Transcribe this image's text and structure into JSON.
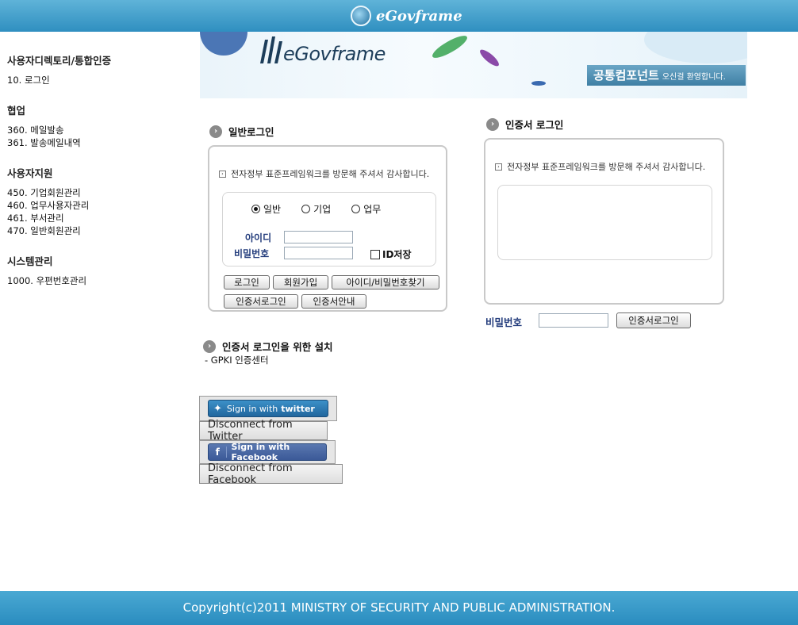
{
  "header": {
    "logo_text": "eGovframe"
  },
  "banner": {
    "brand": "eGovframe",
    "pill_bold": "공통컴포넌트",
    "pill_text": "오신걸 환영합니다."
  },
  "sidebar": {
    "sections": [
      {
        "title": "사용자디렉토리/통합인증",
        "items": [
          "10. 로그인"
        ]
      },
      {
        "title": "협업",
        "items": [
          "360. 메일발송",
          "361. 발송메일내역"
        ]
      },
      {
        "title": "사용자지원",
        "items": [
          "450. 기업회원관리",
          "460. 업무사용자관리",
          "461. 부서관리",
          "470. 일반회원관리"
        ]
      },
      {
        "title": "시스템관리",
        "items": [
          "1000. 우편번호관리"
        ]
      }
    ]
  },
  "general_login": {
    "title": "일반로그인",
    "welcome": "전자정부 표준프레임워크를 방문해 주셔서 감사합니다.",
    "radios": [
      {
        "label": "일반",
        "checked": true
      },
      {
        "label": "기업",
        "checked": false
      },
      {
        "label": "업무",
        "checked": false
      }
    ],
    "id_label": "아이디",
    "id_value": "",
    "password_label": "비밀번호",
    "password_value": "",
    "save_id_label": "ID저장",
    "buttons": {
      "login": "로그인",
      "join": "회원가입",
      "find": "아이디/비밀번호찾기",
      "cert_login": "인증서로그인",
      "cert_guide": "인증서안내"
    }
  },
  "cert_login": {
    "title": "인증서 로그인",
    "welcome": "전자정부 표준프레임워크를 방문해 주셔서 감사합니다.",
    "password_label": "비밀번호",
    "password_value": "",
    "button": "인증서로그인"
  },
  "install": {
    "title": "인증서 로그인을 위한 설치",
    "item": "- GPKI 인증센터"
  },
  "social": {
    "twitter_sign_in": "Sign in with",
    "twitter_brand": "twitter",
    "twitter_disconnect": "Disconnect from Twitter",
    "facebook_sign_in": "Sign in with Facebook",
    "facebook_disconnect": "Disconnect from Facebook"
  },
  "footer": {
    "copyright": "Copyright(c)2011 MINISTRY OF SECURITY AND PUBLIC ADMINISTRATION."
  }
}
